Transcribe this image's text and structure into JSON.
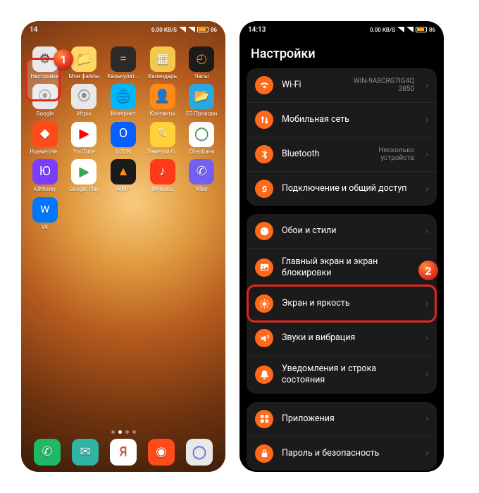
{
  "callouts": {
    "one": "1",
    "two": "2"
  },
  "statusbar": {
    "time_left": "14",
    "time_right": "14:13",
    "speed": "0.00 KB/S",
    "extras": "⋯",
    "battery": "86"
  },
  "home": {
    "apps": [
      {
        "label": "Настройки",
        "bg": "#e6e6e6",
        "glyph": "⚙",
        "fg": "#555"
      },
      {
        "label": "Мои файлы",
        "bg": "#ffd766",
        "glyph": "📁",
        "fg": "#fff"
      },
      {
        "label": "Калькулят...",
        "bg": "#2a2a2a",
        "glyph": "=",
        "fg": "#ff8a1a"
      },
      {
        "label": "Календарь",
        "bg": "#f3c94b",
        "glyph": "▦",
        "fg": "#fff"
      },
      {
        "label": "Часы",
        "bg": "#1b1b1b",
        "glyph": "◴",
        "fg": "#ff8a1a"
      },
      {
        "label": "Google",
        "bg": "#e8e8e8",
        "glyph": "⦿",
        "fg": "#888"
      },
      {
        "label": "Игры",
        "bg": "#e8e8e8",
        "glyph": "⦿",
        "fg": "#888"
      },
      {
        "label": "Интернет",
        "bg": "#00b8ff",
        "glyph": "🌐",
        "fg": "#fff"
      },
      {
        "label": "Контакты",
        "bg": "#ff8a1a",
        "glyph": "👤",
        "fg": "#fff"
      },
      {
        "label": "ES Проводн",
        "bg": "#2aa9e0",
        "glyph": "📂",
        "fg": "#fff"
      },
      {
        "label": "Huawei He..",
        "bg": "#ff4a1a",
        "glyph": "◆",
        "fg": "#fff"
      },
      {
        "label": "YouTube",
        "bg": "#fff",
        "glyph": "▶",
        "fg": "#ff0000"
      },
      {
        "label": "OZON",
        "bg": "#0560ff",
        "glyph": "O",
        "fg": "#fff"
      },
      {
        "label": "Заметки G..",
        "bg": "#ffd23a",
        "glyph": "✎",
        "fg": "#fff"
      },
      {
        "label": "СберБанк",
        "bg": "#fff",
        "glyph": "◯",
        "fg": "#1fa038"
      },
      {
        "label": "ЮMoney",
        "bg": "#7b3dff",
        "glyph": "Ю",
        "fg": "#fff"
      },
      {
        "label": "Google Play",
        "bg": "#fff",
        "glyph": "▶",
        "fg": "#34a853"
      },
      {
        "label": "AIMP",
        "bg": "#1b1b1b",
        "glyph": "▲",
        "fg": "#ff8a1a"
      },
      {
        "label": "Музыка",
        "bg": "#ff3a1a",
        "glyph": "♪",
        "fg": "#fff"
      },
      {
        "label": "Viber",
        "bg": "#7360f2",
        "glyph": "✆",
        "fg": "#fff"
      },
      {
        "label": "VK",
        "bg": "#0077ff",
        "glyph": "w",
        "fg": "#fff"
      }
    ],
    "dock": [
      {
        "name": "phone",
        "bg": "#1fb866",
        "glyph": "✆",
        "fg": "#fff"
      },
      {
        "name": "messages",
        "bg": "#2fb4a4",
        "glyph": "✉",
        "fg": "#fff"
      },
      {
        "name": "yandex",
        "bg": "#fff",
        "glyph": "Я",
        "fg": "#ff3a1a"
      },
      {
        "name": "browser",
        "bg": "#ff4a1a",
        "glyph": "◉",
        "fg": "#fff"
      },
      {
        "name": "camera",
        "bg": "#e8e8e8",
        "glyph": "◯",
        "fg": "#3a6fff"
      }
    ]
  },
  "settings": {
    "title": "Настройки",
    "group1": [
      {
        "icon": "wifi",
        "label": "Wi-Fi",
        "val": "WIN-9A8CRG7IG4Q 3850"
      },
      {
        "icon": "updown",
        "label": "Мобильная сеть",
        "val": ""
      },
      {
        "icon": "bt",
        "label": "Bluetooth",
        "val": "Несколько устройств"
      },
      {
        "icon": "link",
        "label": "Подключение и общий доступ",
        "val": ""
      }
    ],
    "group2": [
      {
        "icon": "palette",
        "label": "Обои и стили",
        "val": ""
      },
      {
        "icon": "image",
        "label": "Главный экран и экран блокировки",
        "val": ""
      },
      {
        "icon": "sun",
        "label": "Экран и яркость",
        "val": ""
      },
      {
        "icon": "sound",
        "label": "Звуки и вибрация",
        "val": ""
      },
      {
        "icon": "bell",
        "label": "Уведомления и строка состояния",
        "val": ""
      }
    ],
    "group3": [
      {
        "icon": "apps",
        "label": "Приложения",
        "val": ""
      },
      {
        "icon": "lock",
        "label": "Пароль и безопасность",
        "val": ""
      }
    ]
  }
}
